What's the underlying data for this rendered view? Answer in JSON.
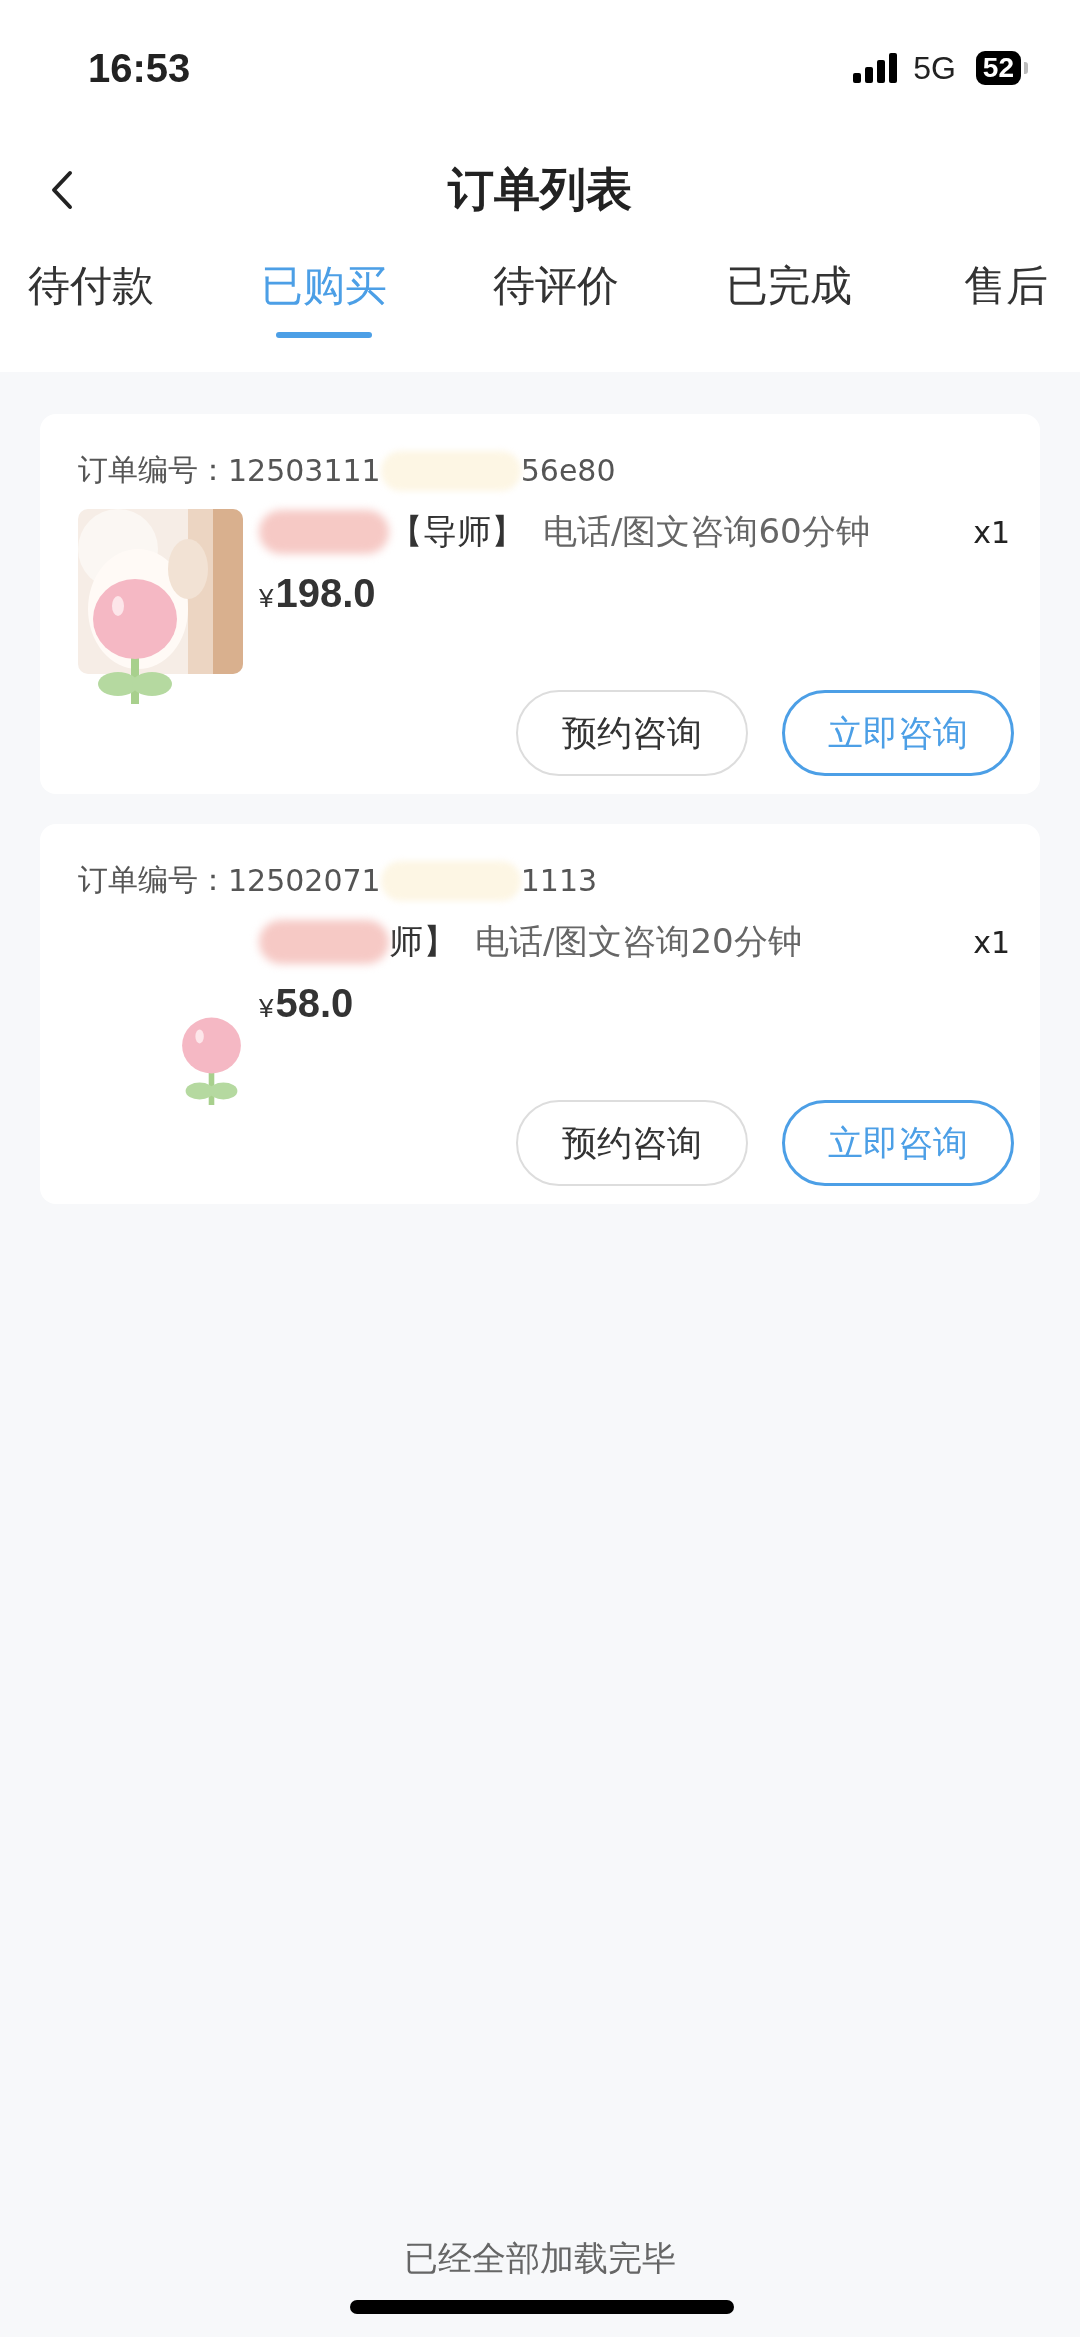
{
  "status_bar": {
    "time": "16:53",
    "network": "5G",
    "battery": "52"
  },
  "nav": {
    "title": "订单列表"
  },
  "tabs": [
    {
      "label": "待付款",
      "selected": false
    },
    {
      "label": "已购买",
      "selected": true
    },
    {
      "label": "待评价",
      "selected": false
    },
    {
      "label": "已完成",
      "selected": false
    },
    {
      "label": "售后",
      "selected": false
    }
  ],
  "orders": [
    {
      "order_label": "订单编号：",
      "order_no_start": "12503111",
      "order_no_end": "56e80",
      "product_type": "【导师】",
      "product": "电话/图文咨询60分钟",
      "quantity": "x1",
      "currency": "¥",
      "price": "198.0",
      "buttons": [
        {
          "label": "预约咨询",
          "kind": "secondary"
        },
        {
          "label": "立即咨询",
          "kind": "primary"
        }
      ]
    },
    {
      "order_label": "订单编号：",
      "order_no_start": "12502071",
      "order_no_end": "1113",
      "product_type": "师】",
      "product": "电话/图文咨询20分钟",
      "quantity": "x1",
      "currency": "¥",
      "price": "58.0",
      "buttons": [
        {
          "label": "预约咨询",
          "kind": "secondary"
        },
        {
          "label": "立即咨询",
          "kind": "primary"
        }
      ]
    }
  ],
  "footer": "已经全部加载完毕"
}
